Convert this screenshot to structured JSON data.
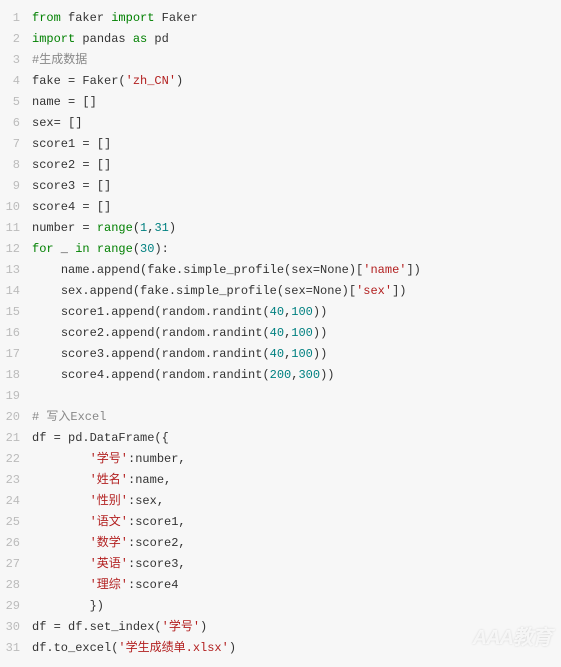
{
  "watermark": "AAA教育",
  "lines": [
    {
      "n": 1,
      "indent": 0,
      "tokens": [
        [
          "kw",
          "from"
        ],
        [
          "",
          ""
        ],
        [
          "id",
          " faker "
        ],
        [
          "kw",
          "import"
        ],
        [
          "id",
          " Faker"
        ]
      ]
    },
    {
      "n": 2,
      "indent": 0,
      "tokens": [
        [
          "kw",
          "import"
        ],
        [
          "id",
          " pandas "
        ],
        [
          "kw",
          "as"
        ],
        [
          "id",
          " pd"
        ]
      ]
    },
    {
      "n": 3,
      "indent": 0,
      "tokens": [
        [
          "cmt",
          "#生成数据"
        ]
      ]
    },
    {
      "n": 4,
      "indent": 0,
      "tokens": [
        [
          "id",
          "fake = Faker("
        ],
        [
          "str",
          "'zh_CN'"
        ],
        [
          "id",
          ")"
        ]
      ]
    },
    {
      "n": 5,
      "indent": 0,
      "tokens": [
        [
          "id",
          "name = []"
        ]
      ]
    },
    {
      "n": 6,
      "indent": 0,
      "tokens": [
        [
          "id",
          "sex= []"
        ]
      ]
    },
    {
      "n": 7,
      "indent": 0,
      "tokens": [
        [
          "id",
          "score1 = []"
        ]
      ]
    },
    {
      "n": 8,
      "indent": 0,
      "tokens": [
        [
          "id",
          "score2 = []"
        ]
      ]
    },
    {
      "n": 9,
      "indent": 0,
      "tokens": [
        [
          "id",
          "score3 = []"
        ]
      ]
    },
    {
      "n": 10,
      "indent": 0,
      "tokens": [
        [
          "id",
          "score4 = []"
        ]
      ]
    },
    {
      "n": 11,
      "indent": 0,
      "tokens": [
        [
          "id",
          "number = "
        ],
        [
          "kw",
          "range"
        ],
        [
          "id",
          "("
        ],
        [
          "num",
          "1"
        ],
        [
          "id",
          ","
        ],
        [
          "num",
          "31"
        ],
        [
          "id",
          ")"
        ]
      ]
    },
    {
      "n": 12,
      "indent": 0,
      "tokens": [
        [
          "kw",
          "for"
        ],
        [
          "id",
          " _ "
        ],
        [
          "kw",
          "in"
        ],
        [
          "id",
          " "
        ],
        [
          "kw",
          "range"
        ],
        [
          "id",
          "("
        ],
        [
          "num",
          "30"
        ],
        [
          "id",
          "):"
        ]
      ]
    },
    {
      "n": 13,
      "indent": 1,
      "tokens": [
        [
          "id",
          "name.append(fake.simple_profile(sex=None)["
        ],
        [
          "str",
          "'name'"
        ],
        [
          "id",
          "])"
        ]
      ]
    },
    {
      "n": 14,
      "indent": 1,
      "tokens": [
        [
          "id",
          "sex.append(fake.simple_profile(sex=None)["
        ],
        [
          "str",
          "'sex'"
        ],
        [
          "id",
          "])"
        ]
      ]
    },
    {
      "n": 15,
      "indent": 1,
      "tokens": [
        [
          "id",
          "score1.append(random.randint("
        ],
        [
          "num",
          "40"
        ],
        [
          "id",
          ","
        ],
        [
          "num",
          "100"
        ],
        [
          "id",
          "))"
        ]
      ]
    },
    {
      "n": 16,
      "indent": 1,
      "tokens": [
        [
          "id",
          "score2.append(random.randint("
        ],
        [
          "num",
          "40"
        ],
        [
          "id",
          ","
        ],
        [
          "num",
          "100"
        ],
        [
          "id",
          "))"
        ]
      ]
    },
    {
      "n": 17,
      "indent": 1,
      "tokens": [
        [
          "id",
          "score3.append(random.randint("
        ],
        [
          "num",
          "40"
        ],
        [
          "id",
          ","
        ],
        [
          "num",
          "100"
        ],
        [
          "id",
          "))"
        ]
      ]
    },
    {
      "n": 18,
      "indent": 1,
      "tokens": [
        [
          "id",
          "score4.append(random.randint("
        ],
        [
          "num",
          "200"
        ],
        [
          "id",
          ","
        ],
        [
          "num",
          "300"
        ],
        [
          "id",
          "))"
        ]
      ]
    },
    {
      "n": 19,
      "indent": 0,
      "tokens": [
        [
          "id",
          ""
        ]
      ]
    },
    {
      "n": 20,
      "indent": 0,
      "tokens": [
        [
          "cmt",
          "# 写入Excel"
        ]
      ]
    },
    {
      "n": 21,
      "indent": 0,
      "tokens": [
        [
          "id",
          "df = pd.DataFrame({"
        ]
      ]
    },
    {
      "n": 22,
      "indent": 2,
      "tokens": [
        [
          "str",
          "'学号'"
        ],
        [
          "id",
          ":number,"
        ]
      ]
    },
    {
      "n": 23,
      "indent": 2,
      "tokens": [
        [
          "str",
          "'姓名'"
        ],
        [
          "id",
          ":name,"
        ]
      ]
    },
    {
      "n": 24,
      "indent": 2,
      "tokens": [
        [
          "str",
          "'性别'"
        ],
        [
          "id",
          ":sex,"
        ]
      ]
    },
    {
      "n": 25,
      "indent": 2,
      "tokens": [
        [
          "str",
          "'语文'"
        ],
        [
          "id",
          ":score1,"
        ]
      ]
    },
    {
      "n": 26,
      "indent": 2,
      "tokens": [
        [
          "str",
          "'数学'"
        ],
        [
          "id",
          ":score2,"
        ]
      ]
    },
    {
      "n": 27,
      "indent": 2,
      "tokens": [
        [
          "str",
          "'英语'"
        ],
        [
          "id",
          ":score3,"
        ]
      ]
    },
    {
      "n": 28,
      "indent": 2,
      "tokens": [
        [
          "str",
          "'理综'"
        ],
        [
          "id",
          ":score4"
        ]
      ]
    },
    {
      "n": 29,
      "indent": 2,
      "tokens": [
        [
          "id",
          "})"
        ]
      ]
    },
    {
      "n": 30,
      "indent": 0,
      "tokens": [
        [
          "id",
          "df = df.set_index("
        ],
        [
          "str",
          "'学号'"
        ],
        [
          "id",
          ")"
        ]
      ]
    },
    {
      "n": 31,
      "indent": 0,
      "tokens": [
        [
          "id",
          "df.to_excel("
        ],
        [
          "str",
          "'学生成绩单.xlsx'"
        ],
        [
          "id",
          ")"
        ]
      ]
    }
  ]
}
